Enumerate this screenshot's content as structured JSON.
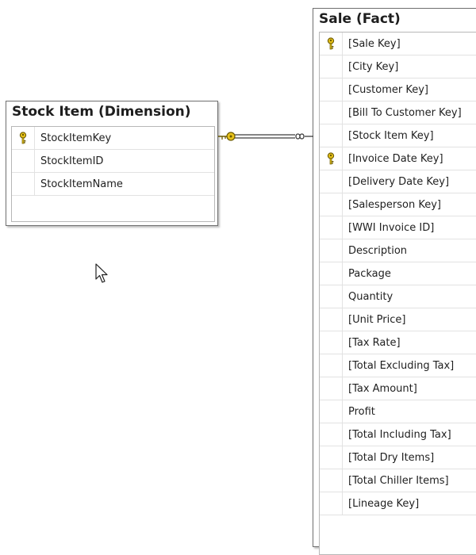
{
  "stock_item": {
    "title": "Stock Item (Dimension)",
    "columns": [
      {
        "label": "StockItemKey",
        "primary_key": true
      },
      {
        "label": "StockItemID",
        "primary_key": false
      },
      {
        "label": "StockItemName",
        "primary_key": false
      }
    ]
  },
  "sale": {
    "title": "Sale (Fact)",
    "columns": [
      {
        "label": "[Sale Key]",
        "primary_key": true
      },
      {
        "label": "[City Key]",
        "primary_key": false
      },
      {
        "label": "[Customer Key]",
        "primary_key": false
      },
      {
        "label": "[Bill To Customer Key]",
        "primary_key": false
      },
      {
        "label": "[Stock Item Key]",
        "primary_key": false
      },
      {
        "label": "[Invoice Date Key]",
        "primary_key": true
      },
      {
        "label": "[Delivery Date Key]",
        "primary_key": false
      },
      {
        "label": "[Salesperson Key]",
        "primary_key": false
      },
      {
        "label": "[WWI Invoice ID]",
        "primary_key": false
      },
      {
        "label": "Description",
        "primary_key": false
      },
      {
        "label": "Package",
        "primary_key": false
      },
      {
        "label": "Quantity",
        "primary_key": false
      },
      {
        "label": "[Unit Price]",
        "primary_key": false
      },
      {
        "label": "[Tax Rate]",
        "primary_key": false
      },
      {
        "label": "[Total Excluding Tax]",
        "primary_key": false
      },
      {
        "label": "[Tax Amount]",
        "primary_key": false
      },
      {
        "label": "Profit",
        "primary_key": false
      },
      {
        "label": "[Total Including Tax]",
        "primary_key": false
      },
      {
        "label": "[Total Dry Items]",
        "primary_key": false
      },
      {
        "label": "[Total Chiller Items]",
        "primary_key": false
      },
      {
        "label": "[Lineage Key]",
        "primary_key": false
      }
    ]
  },
  "relationship": {
    "from": "stock_item",
    "to": "sale",
    "one_end_icon": "key-icon",
    "many_end_icon": "infinity-icon"
  },
  "colors": {
    "key_fill": "#e8c21a",
    "key_stroke": "#6b5a00",
    "line": "#3c3c3c",
    "border": "#6f6f6f"
  }
}
